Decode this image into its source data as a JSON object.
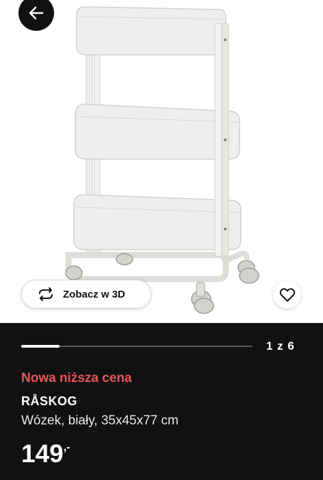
{
  "product": {
    "badge": "Nowa niższa cena",
    "name": "RÅSKOG",
    "description": "Wózek, biały, 35x45x77 cm",
    "price_main": "149",
    "price_decimal": ",-"
  },
  "gallery": {
    "view_3d_label": "Zobacz w 3D",
    "counter": "1 z 6",
    "progress": 0.1667
  },
  "icons": {
    "back": "arrow-left-icon",
    "view_3d": "rotate-arrows-icon",
    "favorite": "heart-icon"
  },
  "colors": {
    "badge": "#e8575a",
    "info_background": "#111111",
    "cart_white": "#eeeeec"
  }
}
